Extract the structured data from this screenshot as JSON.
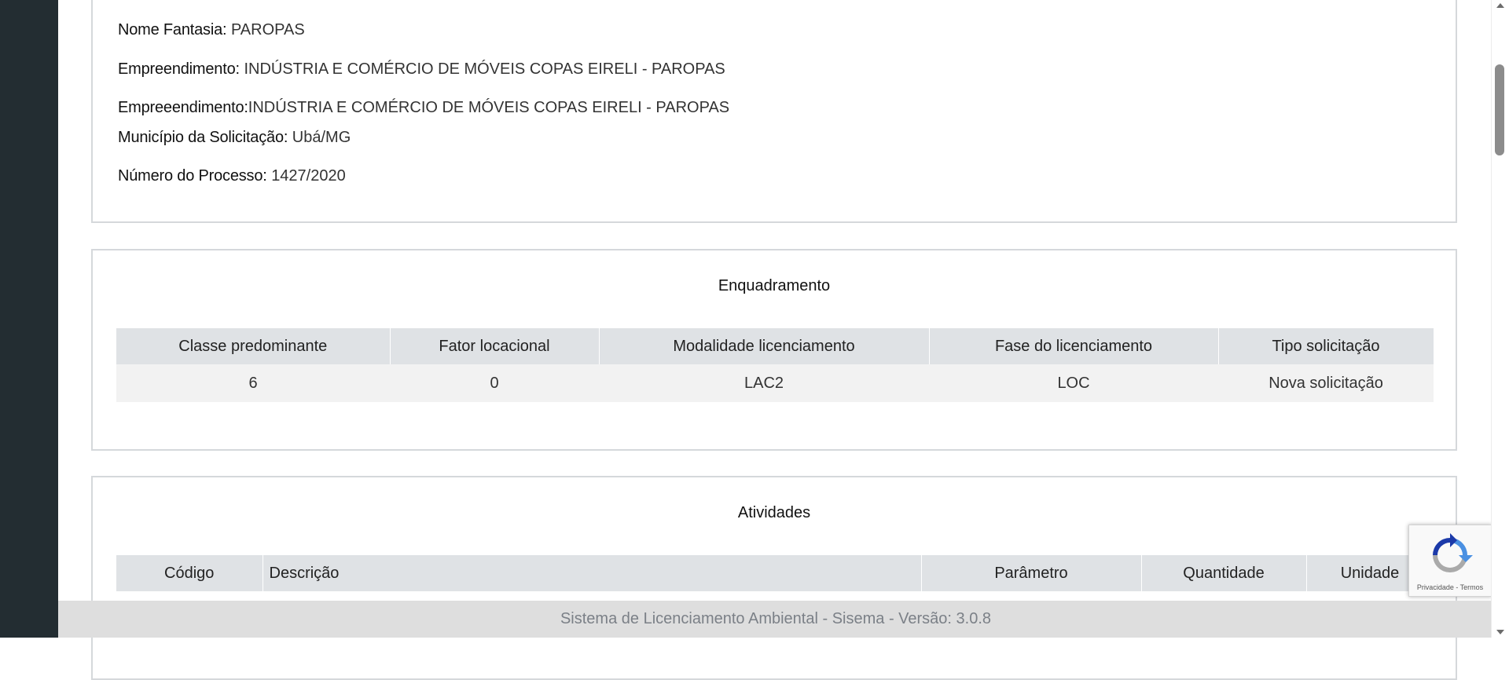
{
  "info": {
    "nome_fantasia_label": "Nome Fantasia:",
    "nome_fantasia_value": "PAROPAS",
    "empreendimento_label": "Empreendimento:",
    "empreendimento_value": "INDÚSTRIA E COMÉRCIO DE MÓVEIS COPAS EIRELI - PAROPAS",
    "empreeendimento_label": "Empreeendimento:",
    "empreeendimento_value": "INDÚSTRIA E COMÉRCIO DE MÓVEIS COPAS EIRELI - PAROPAS",
    "municipio_label": "Município da Solicitação:",
    "municipio_value": "Ubá/MG",
    "processo_label": "Número do Processo:",
    "processo_value": "1427/2020"
  },
  "enquadramento": {
    "title": "Enquadramento",
    "headers": [
      "Classe predominante",
      "Fator locacional",
      "Modalidade licenciamento",
      "Fase do licenciamento",
      "Tipo solicitação"
    ],
    "row": [
      "6",
      "0",
      "LAC2",
      "LOC",
      "Nova solicitação"
    ]
  },
  "atividades": {
    "title": "Atividades",
    "headers": [
      "Código",
      "Descrição",
      "Parâmetro",
      "Quantidade",
      "Unidade"
    ]
  },
  "footer": {
    "text": "Sistema de Licenciamento Ambiental - Sisema - Versão: 3.0.8"
  },
  "recaptcha": {
    "links": "Privacidade - Termos",
    "colors": {
      "blue": "#1c3aa9",
      "lightblue": "#4a90e2",
      "gray": "#aaaaaa"
    }
  },
  "icons": [
    "recaptcha-logo-icon",
    "scroll-up-arrow-icon",
    "scroll-down-arrow-icon"
  ]
}
